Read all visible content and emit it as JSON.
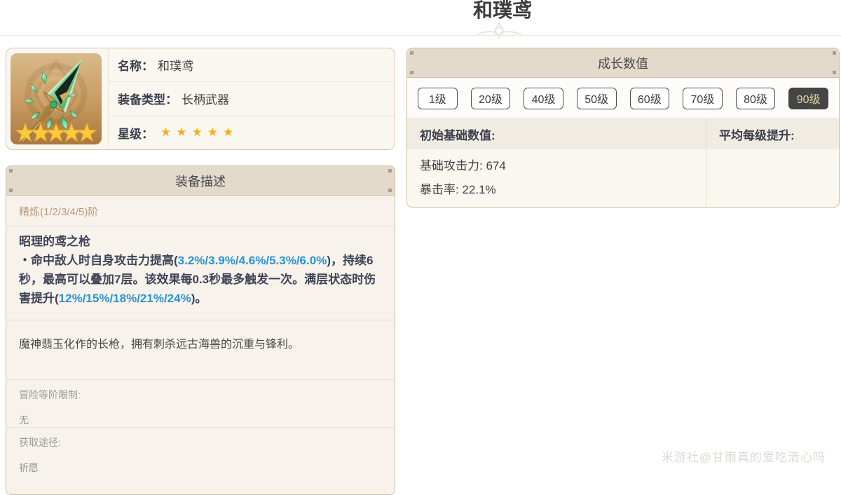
{
  "page": {
    "title": "和璞鸢",
    "watermark": "米游社@甘雨真的爱吃清心吗"
  },
  "icons": {
    "divider_emblem": "lotus-compass-ornament",
    "weapon_image": "jade-winged-spear-art",
    "star_glyph": "★"
  },
  "colors": {
    "accent_blue": "#2a93d5",
    "star_gold": "#f3b01c",
    "active_tab_bg": "#454545",
    "active_tab_text": "#e8d5a5",
    "band_bg": "#e3dacc"
  },
  "info_card": {
    "name_label": "名称：",
    "name_value": "和璞鸢",
    "type_label": "装备类型：",
    "type_value": "长柄武器",
    "star_label": "星级：",
    "stars": "★★★★★",
    "star_count": 5
  },
  "desc_card": {
    "header": "装备描述",
    "refine": "精炼(1/2/3/4/5)阶",
    "passive_name": "昭理的鸢之枪",
    "effect": {
      "p1": "・命中敌人时自身攻击力提高(",
      "b1": "3.2%/3.9%/4.6%/5.3%/6.0%",
      "p2": ")，持续6秒，最高可以叠加7层。该效果每0.3秒最多触发一次。满层状态时伤害提升(",
      "b2": "12%/15%/18%/21%/24%",
      "p3": ")。"
    },
    "flavor": "魔神翡玉化作的长枪，拥有刺杀远古海兽的沉重与锋利。",
    "adventure_rank_label": "冒险等阶限制:",
    "adventure_rank_value": "无",
    "source_label": "获取途径:",
    "source_value": "祈愿"
  },
  "growth_card": {
    "header": "成长数值",
    "levels": [
      {
        "label": "1级",
        "active": false
      },
      {
        "label": "20级",
        "active": false
      },
      {
        "label": "40级",
        "active": false
      },
      {
        "label": "50级",
        "active": false
      },
      {
        "label": "60级",
        "active": false
      },
      {
        "label": "70级",
        "active": false
      },
      {
        "label": "80级",
        "active": false
      },
      {
        "label": "90级",
        "active": true
      }
    ],
    "base_header": "初始基础数值:",
    "avg_header": "平均每级提升:",
    "base_atk": "基础攻击力: 674",
    "crit_rate": "暴击率: 22.1%"
  }
}
